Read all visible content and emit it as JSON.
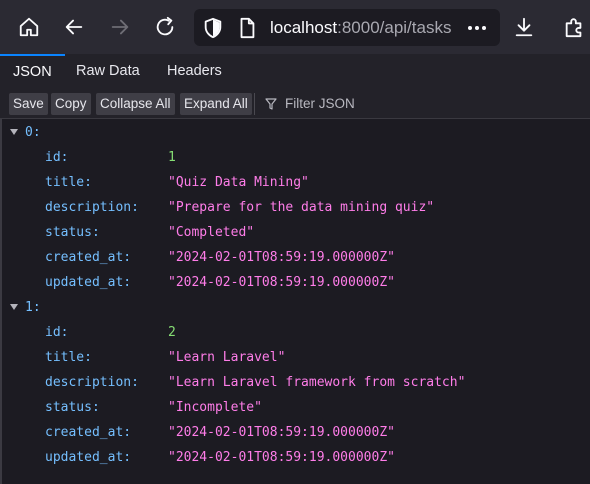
{
  "browser": {
    "url_host": "localhost",
    "url_rest": ":8000/api/tasks"
  },
  "tabs": [
    {
      "label": "JSON"
    },
    {
      "label": "Raw Data"
    },
    {
      "label": "Headers"
    }
  ],
  "actions": {
    "save": "Save",
    "copy": "Copy",
    "collapse_all": "Collapse All",
    "expand_all": "Expand All",
    "filter_placeholder": "Filter JSON"
  },
  "json": {
    "items": [
      {
        "index": "0:",
        "fields": [
          {
            "key": "id:",
            "value": "1",
            "kind": "num"
          },
          {
            "key": "title:",
            "value": "\"Quiz Data Mining\"",
            "kind": "str"
          },
          {
            "key": "description:",
            "value": "\"Prepare for the data mining quiz\"",
            "kind": "str"
          },
          {
            "key": "status:",
            "value": "\"Completed\"",
            "kind": "str"
          },
          {
            "key": "created_at:",
            "value": "\"2024-02-01T08:59:19.000000Z\"",
            "kind": "str"
          },
          {
            "key": "updated_at:",
            "value": "\"2024-02-01T08:59:19.000000Z\"",
            "kind": "str"
          }
        ]
      },
      {
        "index": "1:",
        "fields": [
          {
            "key": "id:",
            "value": "2",
            "kind": "num"
          },
          {
            "key": "title:",
            "value": "\"Learn Laravel\"",
            "kind": "str"
          },
          {
            "key": "description:",
            "value": "\"Learn Laravel framework from scratch\"",
            "kind": "str"
          },
          {
            "key": "status:",
            "value": "\"Incomplete\"",
            "kind": "str"
          },
          {
            "key": "created_at:",
            "value": "\"2024-02-01T08:59:19.000000Z\"",
            "kind": "str"
          },
          {
            "key": "updated_at:",
            "value": "\"2024-02-01T08:59:19.000000Z\"",
            "kind": "str"
          }
        ]
      }
    ]
  }
}
